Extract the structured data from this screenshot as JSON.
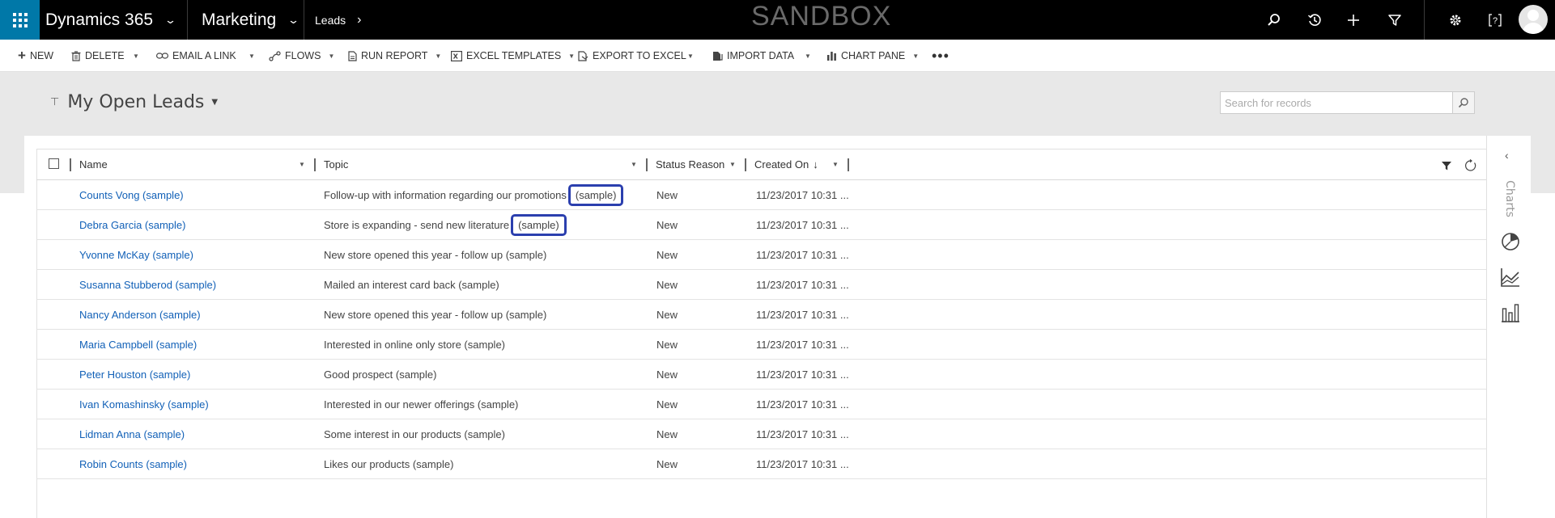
{
  "topbar": {
    "app_name": "Dynamics 365",
    "area": "Marketing",
    "breadcrumb": "Leads",
    "banner": "SANDBOX"
  },
  "commands": {
    "new": "NEW",
    "delete": "DELETE",
    "email_link": "EMAIL A LINK",
    "flows": "FLOWS",
    "run_report": "RUN REPORT",
    "excel_templates": "EXCEL TEMPLATES",
    "export_excel": "EXPORT TO EXCEL",
    "import_data": "IMPORT DATA",
    "chart_pane": "CHART PANE"
  },
  "view": {
    "title": "My Open Leads",
    "search_placeholder": "Search for records"
  },
  "columns": {
    "name": "Name",
    "topic": "Topic",
    "status": "Status Reason",
    "created": "Created On"
  },
  "rows": [
    {
      "name": "Counts Vong (sample)",
      "topic": "Follow-up with information regarding our promotions",
      "topic_suffix": "(sample)",
      "status": "New",
      "created": "11/23/2017 10:31 ..."
    },
    {
      "name": "Debra Garcia (sample)",
      "topic": "Store is expanding - send new literature",
      "topic_suffix": "(sample)",
      "status": "New",
      "created": "11/23/2017 10:31 ..."
    },
    {
      "name": "Yvonne McKay (sample)",
      "topic": "New store opened this year - follow up (sample)",
      "topic_suffix": "",
      "status": "New",
      "created": "11/23/2017 10:31 ..."
    },
    {
      "name": "Susanna Stubberod (sample)",
      "topic": "Mailed an interest card back (sample)",
      "topic_suffix": "",
      "status": "New",
      "created": "11/23/2017 10:31 ..."
    },
    {
      "name": "Nancy Anderson (sample)",
      "topic": "New store opened this year - follow up (sample)",
      "topic_suffix": "",
      "status": "New",
      "created": "11/23/2017 10:31 ..."
    },
    {
      "name": "Maria Campbell (sample)",
      "topic": "Interested in online only store (sample)",
      "topic_suffix": "",
      "status": "New",
      "created": "11/23/2017 10:31 ..."
    },
    {
      "name": "Peter Houston (sample)",
      "topic": "Good prospect (sample)",
      "topic_suffix": "",
      "status": "New",
      "created": "11/23/2017 10:31 ..."
    },
    {
      "name": "Ivan Komashinsky (sample)",
      "topic": "Interested in our newer offerings (sample)",
      "topic_suffix": "",
      "status": "New",
      "created": "11/23/2017 10:31 ..."
    },
    {
      "name": "Lidman Anna (sample)",
      "topic": "Some interest in our products (sample)",
      "topic_suffix": "",
      "status": "New",
      "created": "11/23/2017 10:31 ..."
    },
    {
      "name": "Robin Counts (sample)",
      "topic": "Likes our products (sample)",
      "topic_suffix": "",
      "status": "New",
      "created": "11/23/2017 10:31 ..."
    }
  ],
  "chart_pane": {
    "label": "Charts"
  },
  "colors": {
    "topbar": "#000000",
    "apps_tile": "#0078a8",
    "link": "#1160b7",
    "highlight": "#2b3fae",
    "band": "#e8e8e8"
  },
  "icons": [
    "apps-grid-icon",
    "chevron-down-icon",
    "chevron-right-icon",
    "search-icon",
    "history-icon",
    "plus-icon",
    "filter-icon",
    "gear-icon",
    "help-icon",
    "avatar-icon",
    "pin-icon",
    "refresh-icon",
    "pie-chart-icon",
    "area-chart-icon",
    "bar-chart-icon",
    "more-icon"
  ]
}
